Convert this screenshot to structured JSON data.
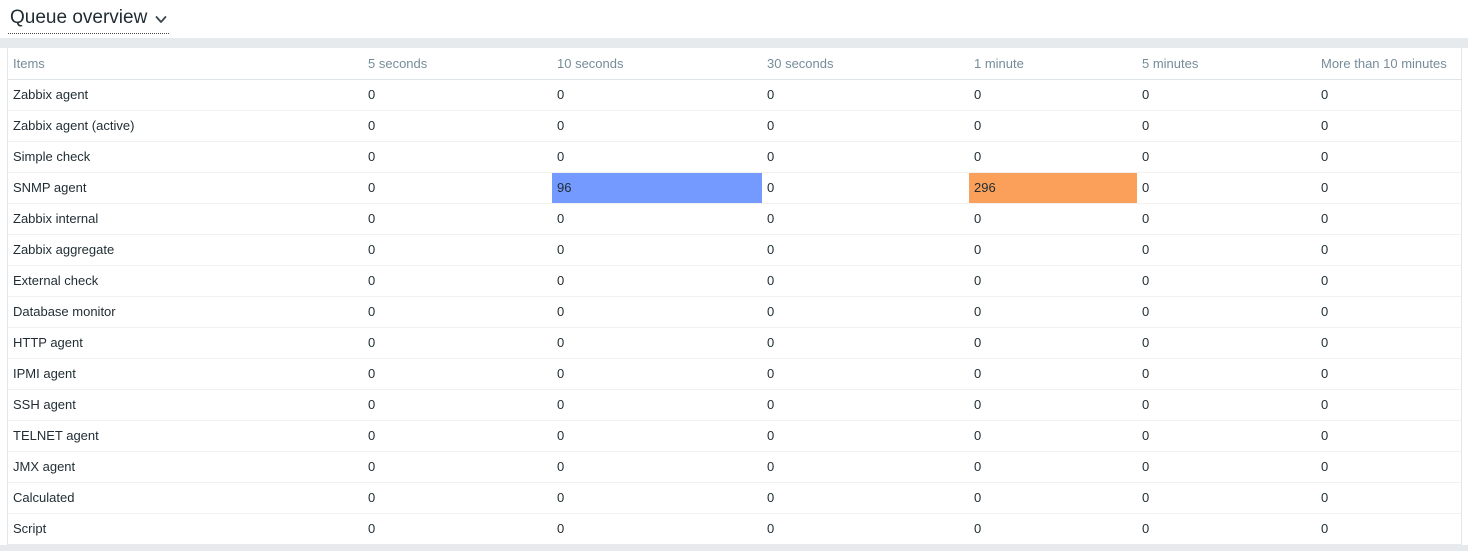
{
  "page": {
    "title": "Queue overview"
  },
  "icons": {
    "title_chevron": "chevron-down"
  },
  "colors": {
    "blue": "#7499ff",
    "orange": "#faa05a",
    "band": "#e6eaed",
    "header_text": "#768d99",
    "cell_text": "#1f2c33"
  },
  "table": {
    "columns": [
      "Items",
      "5 seconds",
      "10 seconds",
      "30 seconds",
      "1 minute",
      "5 minutes",
      "More than 10 minutes"
    ],
    "rows": [
      {
        "item": "Zabbix agent",
        "cells": [
          {
            "v": "0"
          },
          {
            "v": "0"
          },
          {
            "v": "0"
          },
          {
            "v": "0"
          },
          {
            "v": "0"
          },
          {
            "v": "0"
          }
        ]
      },
      {
        "item": "Zabbix agent (active)",
        "cells": [
          {
            "v": "0"
          },
          {
            "v": "0"
          },
          {
            "v": "0"
          },
          {
            "v": "0"
          },
          {
            "v": "0"
          },
          {
            "v": "0"
          }
        ]
      },
      {
        "item": "Simple check",
        "cells": [
          {
            "v": "0"
          },
          {
            "v": "0"
          },
          {
            "v": "0"
          },
          {
            "v": "0"
          },
          {
            "v": "0"
          },
          {
            "v": "0"
          }
        ]
      },
      {
        "item": "SNMP agent",
        "cells": [
          {
            "v": "0"
          },
          {
            "v": "96",
            "bg": "blue"
          },
          {
            "v": "0"
          },
          {
            "v": "296",
            "bg": "orange"
          },
          {
            "v": "0"
          },
          {
            "v": "0"
          }
        ]
      },
      {
        "item": "Zabbix internal",
        "cells": [
          {
            "v": "0"
          },
          {
            "v": "0"
          },
          {
            "v": "0"
          },
          {
            "v": "0"
          },
          {
            "v": "0"
          },
          {
            "v": "0"
          }
        ]
      },
      {
        "item": "Zabbix aggregate",
        "cells": [
          {
            "v": "0"
          },
          {
            "v": "0"
          },
          {
            "v": "0"
          },
          {
            "v": "0"
          },
          {
            "v": "0"
          },
          {
            "v": "0"
          }
        ]
      },
      {
        "item": "External check",
        "cells": [
          {
            "v": "0"
          },
          {
            "v": "0"
          },
          {
            "v": "0"
          },
          {
            "v": "0"
          },
          {
            "v": "0"
          },
          {
            "v": "0"
          }
        ]
      },
      {
        "item": "Database monitor",
        "cells": [
          {
            "v": "0"
          },
          {
            "v": "0"
          },
          {
            "v": "0"
          },
          {
            "v": "0"
          },
          {
            "v": "0"
          },
          {
            "v": "0"
          }
        ]
      },
      {
        "item": "HTTP agent",
        "cells": [
          {
            "v": "0"
          },
          {
            "v": "0"
          },
          {
            "v": "0"
          },
          {
            "v": "0"
          },
          {
            "v": "0"
          },
          {
            "v": "0"
          }
        ]
      },
      {
        "item": "IPMI agent",
        "cells": [
          {
            "v": "0"
          },
          {
            "v": "0"
          },
          {
            "v": "0"
          },
          {
            "v": "0"
          },
          {
            "v": "0"
          },
          {
            "v": "0"
          }
        ]
      },
      {
        "item": "SSH agent",
        "cells": [
          {
            "v": "0"
          },
          {
            "v": "0"
          },
          {
            "v": "0"
          },
          {
            "v": "0"
          },
          {
            "v": "0"
          },
          {
            "v": "0"
          }
        ]
      },
      {
        "item": "TELNET agent",
        "cells": [
          {
            "v": "0"
          },
          {
            "v": "0"
          },
          {
            "v": "0"
          },
          {
            "v": "0"
          },
          {
            "v": "0"
          },
          {
            "v": "0"
          }
        ]
      },
      {
        "item": "JMX agent",
        "cells": [
          {
            "v": "0"
          },
          {
            "v": "0"
          },
          {
            "v": "0"
          },
          {
            "v": "0"
          },
          {
            "v": "0"
          },
          {
            "v": "0"
          }
        ]
      },
      {
        "item": "Calculated",
        "cells": [
          {
            "v": "0"
          },
          {
            "v": "0"
          },
          {
            "v": "0"
          },
          {
            "v": "0"
          },
          {
            "v": "0"
          },
          {
            "v": "0"
          }
        ]
      },
      {
        "item": "Script",
        "cells": [
          {
            "v": "0"
          },
          {
            "v": "0"
          },
          {
            "v": "0"
          },
          {
            "v": "0"
          },
          {
            "v": "0"
          },
          {
            "v": "0"
          }
        ]
      }
    ]
  }
}
